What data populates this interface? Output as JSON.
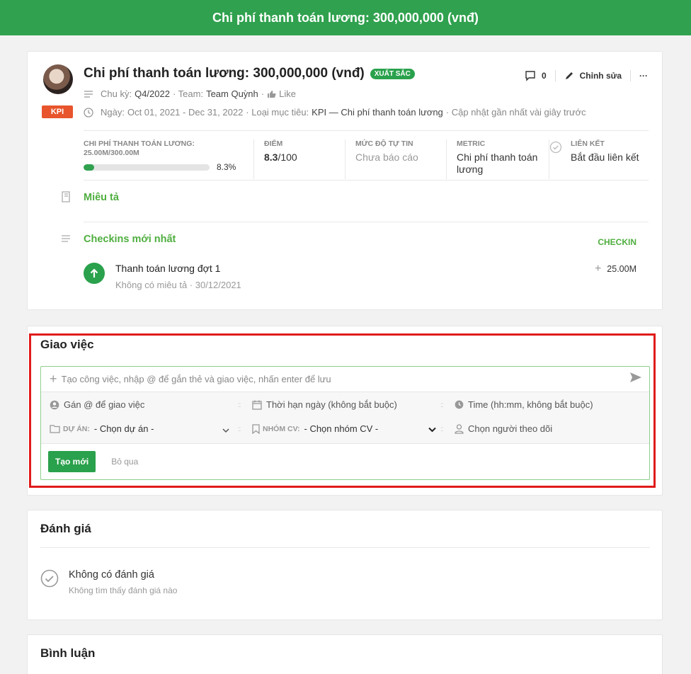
{
  "header": {
    "title": "Chi phí thanh toán lương: 300,000,000 (vnđ)"
  },
  "kpi": {
    "title": "Chi phí thanh toán lương: 300,000,000 (vnđ)",
    "rating_badge": "XUẤT SẮC",
    "type_badge": "KPI",
    "comment_count": "0",
    "edit_label": "Chỉnh sửa",
    "more_label": "···",
    "cycle_label": "Chu kỳ:",
    "cycle_value": "Q4/2022",
    "team_label": "· Team:",
    "team_value": "Team Quỳnh",
    "like_label": "Like",
    "date_label": "Ngày:",
    "date_value": "Oct 01, 2021 - Dec 31, 2022",
    "goal_type_label": "· Loại mục tiêu:",
    "goal_type_value": "KPI — Chi phí thanh toán lương",
    "updated": "· Cập nhật gần nhất vài giây trước"
  },
  "stats": {
    "cost_label": "CHI PHÍ THANH TOÁN LƯƠNG: 25.00M/300.00M",
    "progress_percent": "8.3%",
    "progress_fraction": 0.083,
    "score_label": "ĐIỂM",
    "score_value": "8.3",
    "score_max": "/100",
    "confidence_label": "MỨC ĐỘ TỰ TIN",
    "confidence_value": "Chưa báo cáo",
    "metric_label": "METRIC",
    "metric_value": "Chi phí thanh toán lương",
    "link_label": "LIÊN KẾT",
    "link_value": "Bắt đầu liên kết"
  },
  "description": {
    "title": "Miêu tả"
  },
  "checkins": {
    "title": "Checkins mới nhất",
    "action_label": "CHECKIN",
    "items": [
      {
        "title": "Thanh toán lương đợt 1",
        "sub": "Không có miêu tả · 30/12/2021",
        "amount": "25.00M"
      }
    ]
  },
  "tasks": {
    "title": "Giao việc",
    "input_placeholder": "Tạo công việc, nhập @ để gắn thẻ và giao việc, nhấn enter để lưu",
    "assign": "Gán @ để giao việc",
    "deadline": "Thời hạn ngày (không bắt buộc)",
    "time": "Time (hh:mm, không bắt buộc)",
    "project_label": "DỰ ÁN:",
    "project_value": "- Chọn dự án -",
    "group_label": "NHÓM CV:",
    "group_value": "- Chọn nhóm CV -",
    "followers": "Chọn người theo dõi",
    "create_label": "Tạo mới",
    "skip_label": "Bỏ qua"
  },
  "review": {
    "title": "Đánh giá",
    "empty_title": "Không có đánh giá",
    "empty_sub": "Không tìm thấy đánh giá nào"
  },
  "comments": {
    "title": "Bình luận"
  },
  "colors": {
    "primary": "#30a14e",
    "accent_green": "#4fae3f",
    "kpi_badge": "#e8542b",
    "highlight": "#e01b1b"
  }
}
